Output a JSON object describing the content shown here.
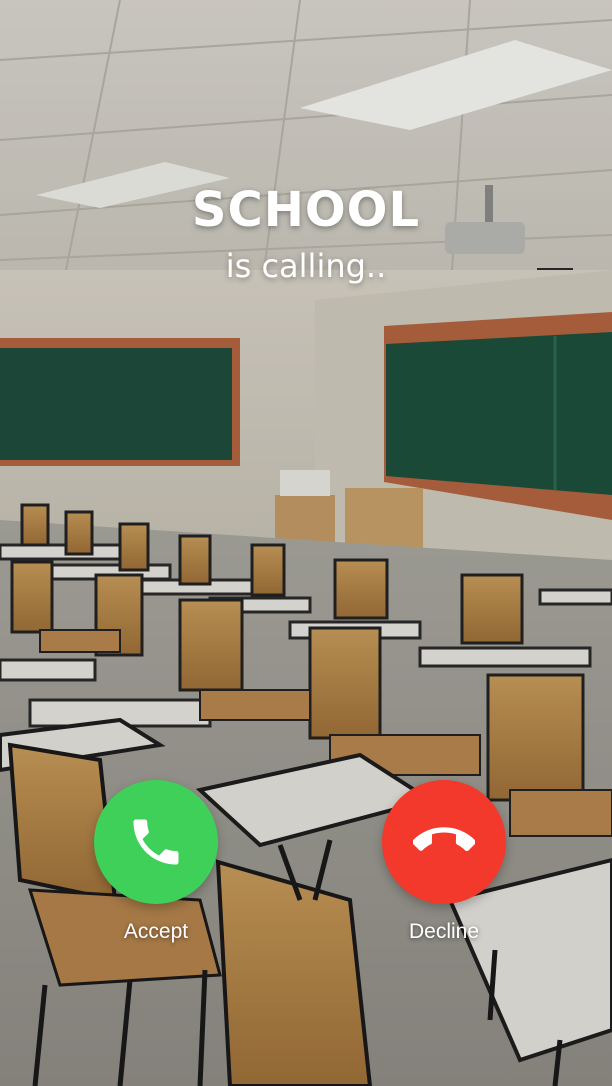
{
  "caller": {
    "name": "SCHOOL",
    "status": "is calling.."
  },
  "actions": {
    "accept_label": "Accept",
    "decline_label": "Decline",
    "accept_color": "#3fd05a",
    "decline_color": "#f2392c"
  },
  "icons": {
    "accept": "phone-icon",
    "decline": "hang-up-phone-icon"
  }
}
